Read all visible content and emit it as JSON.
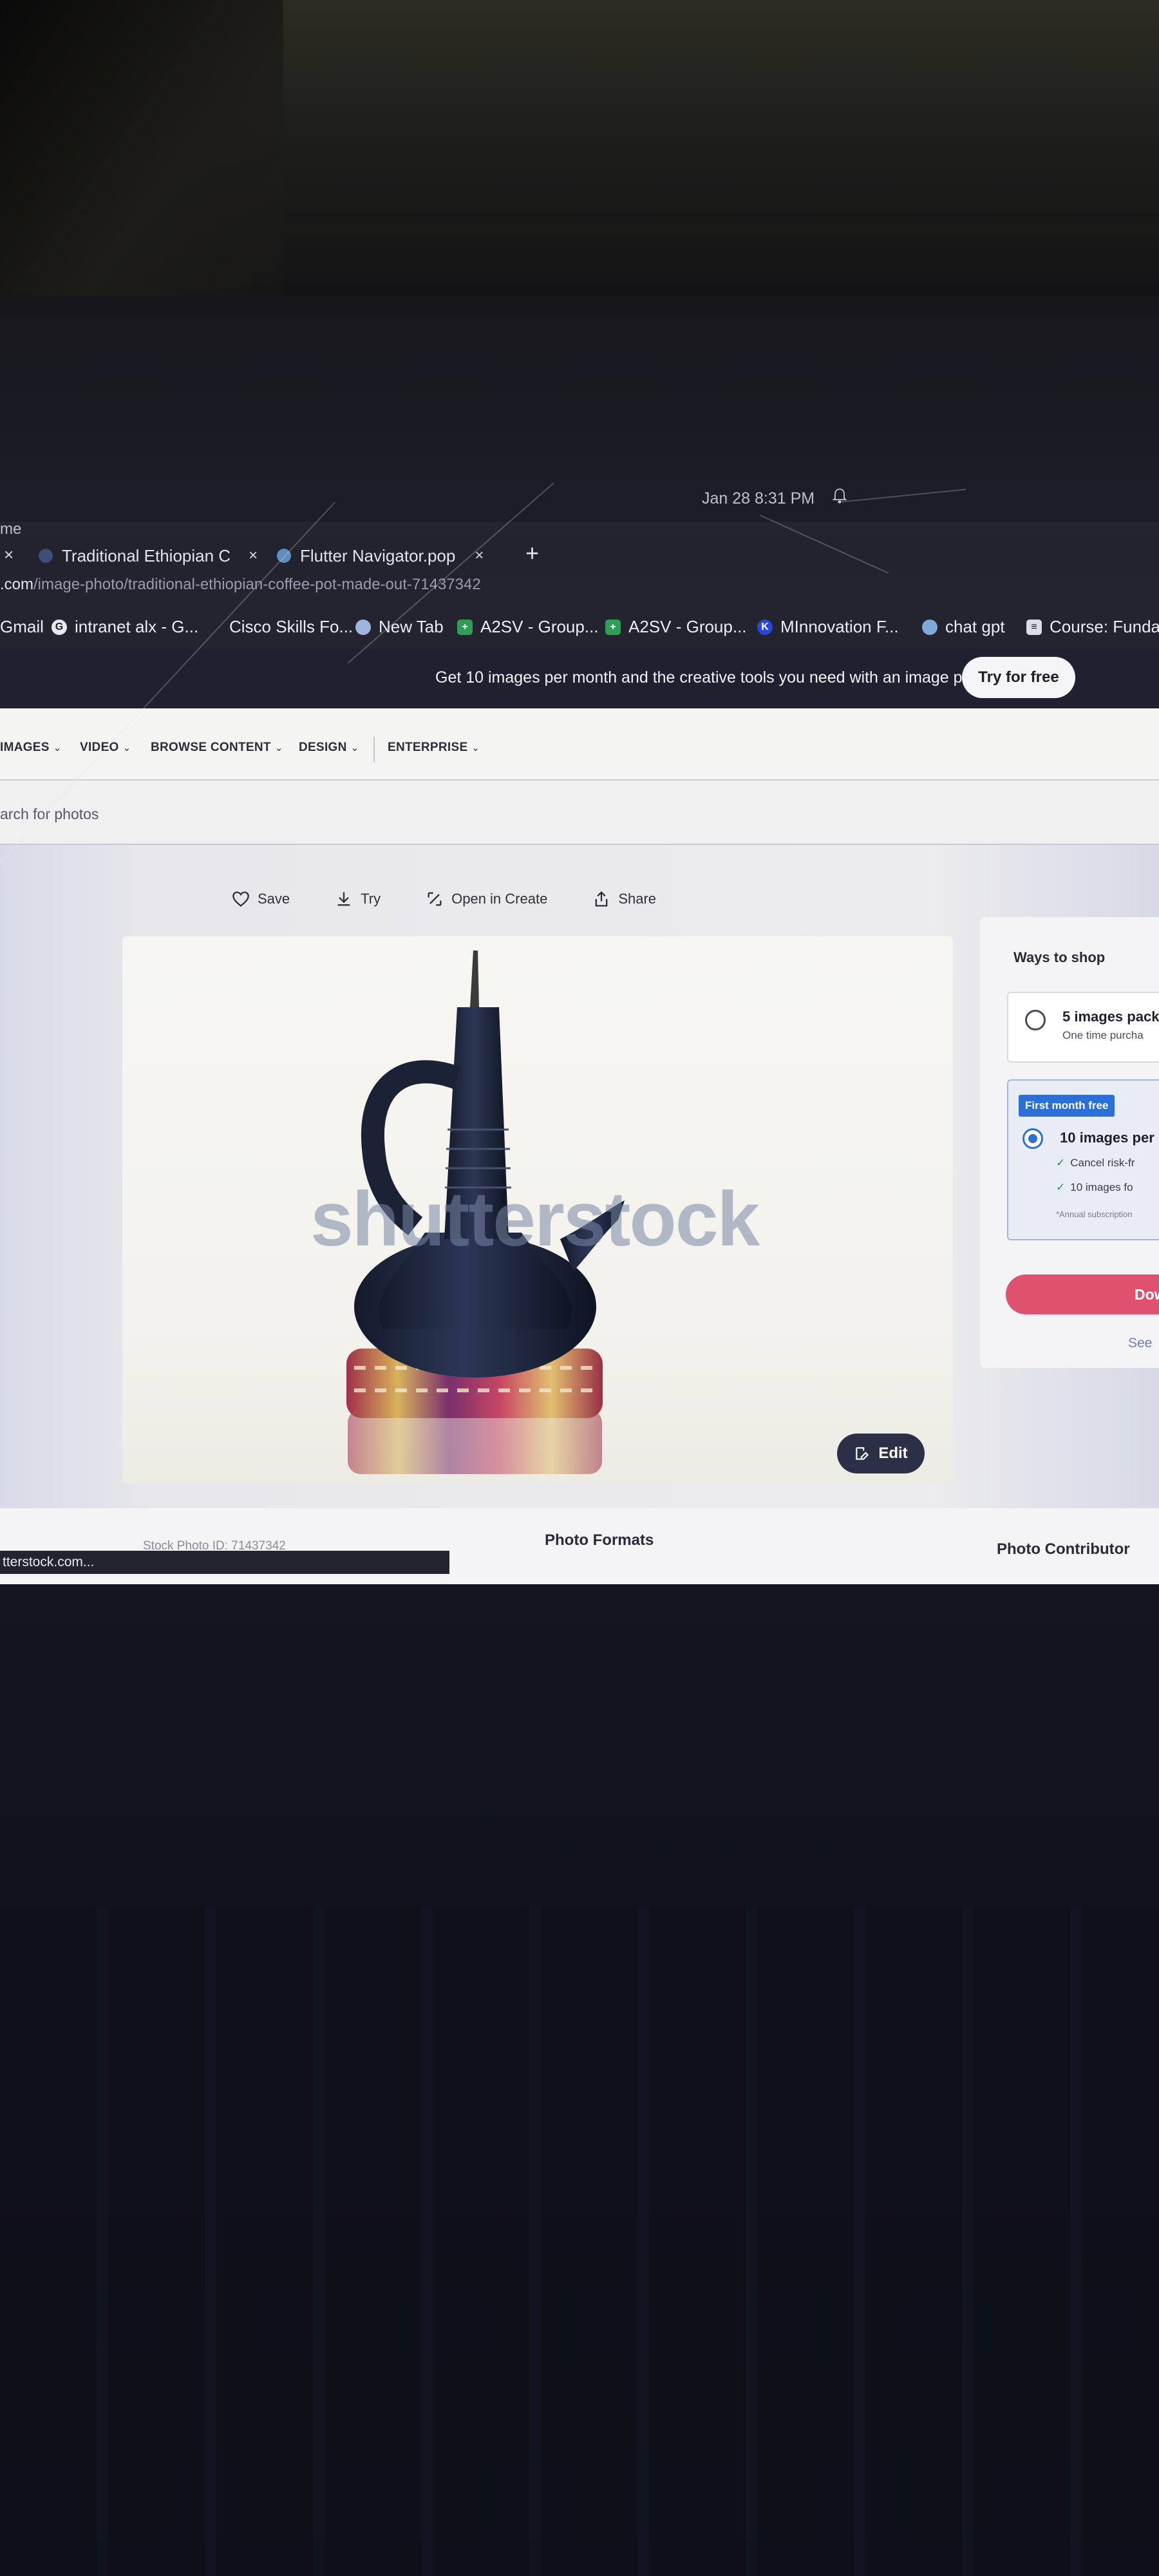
{
  "os": {
    "clock": "Jan 28  8:31 PM",
    "app_fragment": "me"
  },
  "tabs": [
    {
      "label": "Traditional Ethiopian C",
      "close": "×"
    },
    {
      "label": "Flutter Navigator.pop",
      "close": "×"
    }
  ],
  "tab_left_close": "×",
  "new_tab_symbol": "+",
  "address": {
    "domain": ".com",
    "path": "/image-photo/traditional-ethiopian-coffee-pot-made-out-71437342"
  },
  "bookmarks": [
    {
      "label": "Gmail",
      "icon": "none"
    },
    {
      "label": "intranet alx - G...",
      "icon": "google-icon"
    },
    {
      "label": "Cisco Skills Fo...",
      "icon": "none"
    },
    {
      "label": "New Tab",
      "icon": "globe-icon"
    },
    {
      "label": "A2SV - Group...",
      "icon": "sheets-icon"
    },
    {
      "label": "A2SV - Group...",
      "icon": "sheets-icon"
    },
    {
      "label": "MInnovation F...",
      "icon": "k-icon"
    },
    {
      "label": "chat gpt",
      "icon": "globe-icon"
    },
    {
      "label": "Course: Funda",
      "icon": "doc-icon"
    }
  ],
  "promo": {
    "text": "Get 10 images per month and the creative tools you need with an image plan.",
    "button": "Try for free"
  },
  "nav": [
    {
      "label": "IMAGES"
    },
    {
      "label": "VIDEO"
    },
    {
      "label": "BROWSE CONTENT"
    },
    {
      "label": "DESIGN"
    },
    {
      "label": "ENTERPRISE"
    }
  ],
  "search": {
    "placeholder": "arch for photos"
  },
  "actions": [
    {
      "label": "Save",
      "icon": "heart-icon"
    },
    {
      "label": "Try",
      "icon": "download-icon"
    },
    {
      "label": "Open in Create",
      "icon": "create-icon"
    },
    {
      "label": "Share",
      "icon": "share-icon"
    }
  ],
  "preview": {
    "watermark": "shutterstock",
    "edit_label": "Edit"
  },
  "shop": {
    "title": "Ways to shop",
    "option1": {
      "title": "5 images pack",
      "sub": "One time purcha"
    },
    "option2": {
      "badge": "First month free",
      "title": "10 images per",
      "bullets": [
        "Cancel risk-fr",
        "10 images fo"
      ],
      "fineprint": "*Annual subscription"
    },
    "download_label": "Dow",
    "see_link": "See"
  },
  "meta": {
    "stock_id": "Stock Photo ID: 71437342",
    "formats": "Photo Formats",
    "contributor": "Photo Contributor"
  },
  "status_url": "tterstock.com...",
  "colors": {
    "accent_blue": "#2c6fd6",
    "download_pink": "#e0506f",
    "promo_dark": "#1f2030"
  }
}
